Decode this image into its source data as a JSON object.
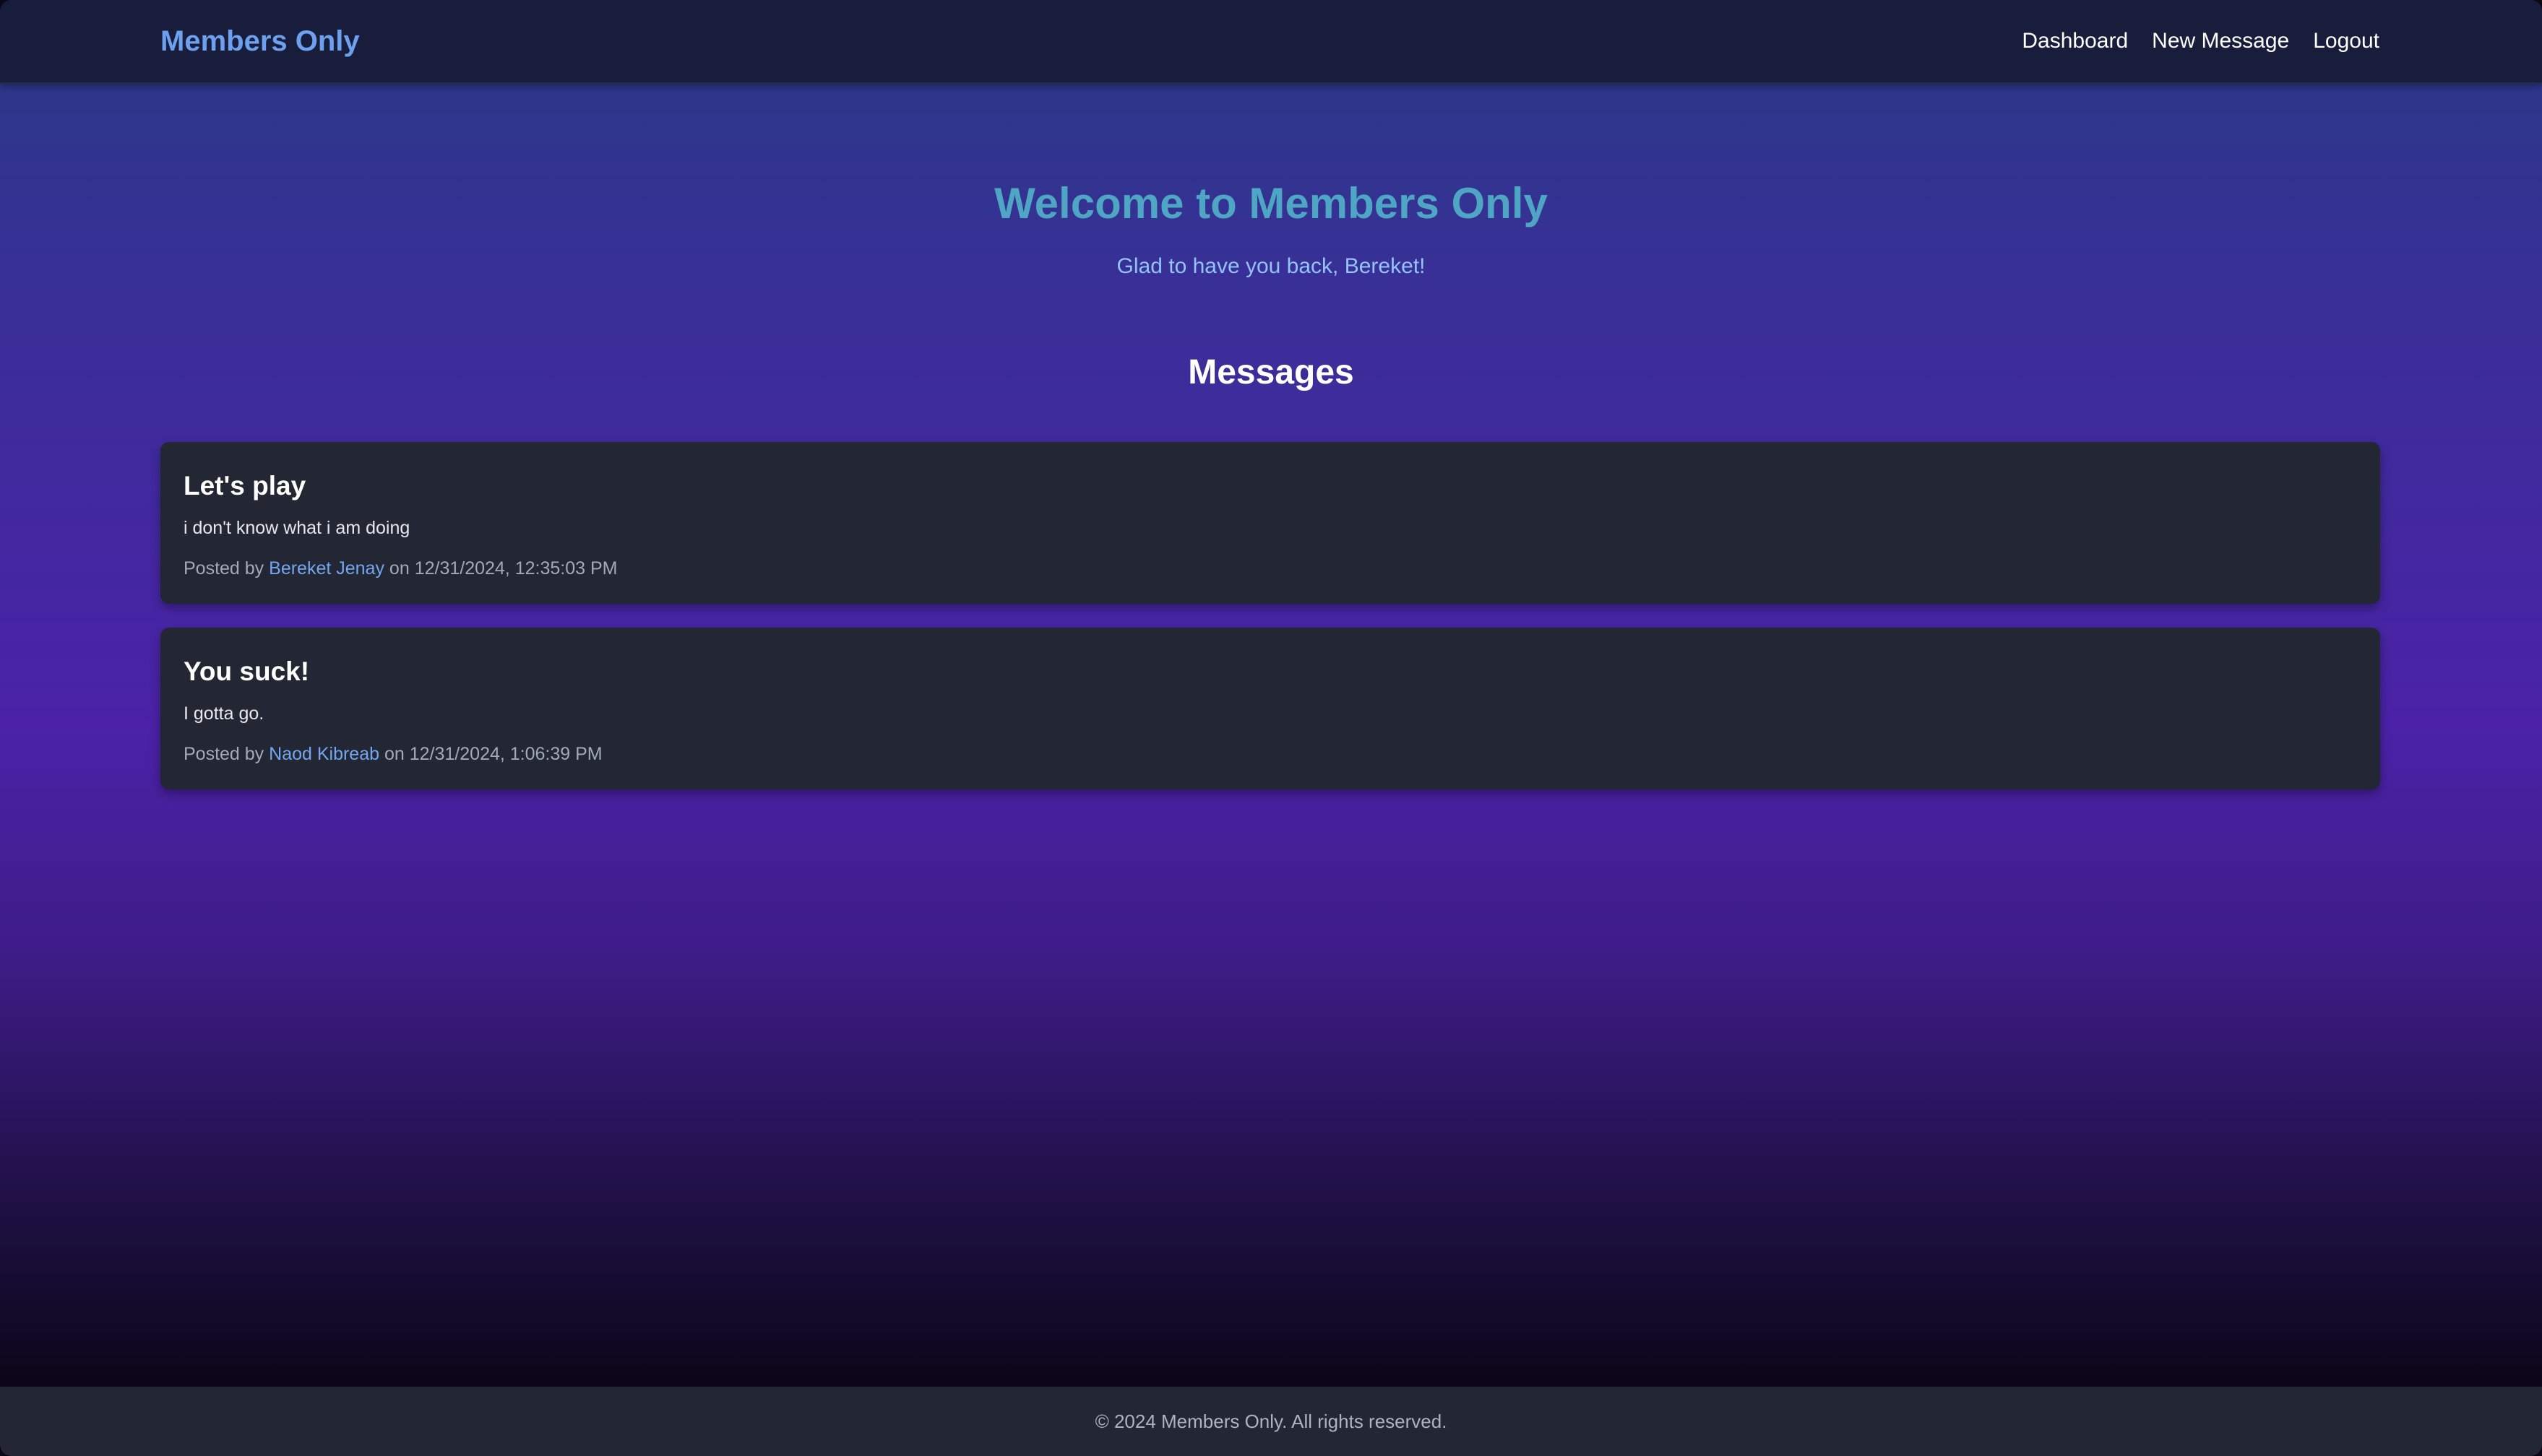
{
  "navbar": {
    "brand": "Members Only",
    "links": [
      {
        "label": "Dashboard"
      },
      {
        "label": "New Message"
      },
      {
        "label": "Logout"
      }
    ]
  },
  "hero": {
    "title": "Welcome to Members Only",
    "subtitle": "Glad to have you back, Bereket!"
  },
  "messages_section": {
    "title": "Messages",
    "posted_by_prefix": "Posted by",
    "on_word": "on",
    "items": [
      {
        "title": "Let's play",
        "body": "i don't know what i am doing",
        "author": "Bereket Jenay",
        "timestamp": "12/31/2024, 12:35:03 PM"
      },
      {
        "title": "You suck!",
        "body": "I gotta go.",
        "author": "Naod Kibreab",
        "timestamp": "12/31/2024, 1:06:39 PM"
      }
    ]
  },
  "footer": {
    "text": "© 2024 Members Only. All rights reserved."
  },
  "colors": {
    "navbar_bg": "#171d3a",
    "brand": "#6ea0f0",
    "hero_title": "#4fa6c4",
    "card_bg": "#222733",
    "author_link": "#74a6f0"
  }
}
